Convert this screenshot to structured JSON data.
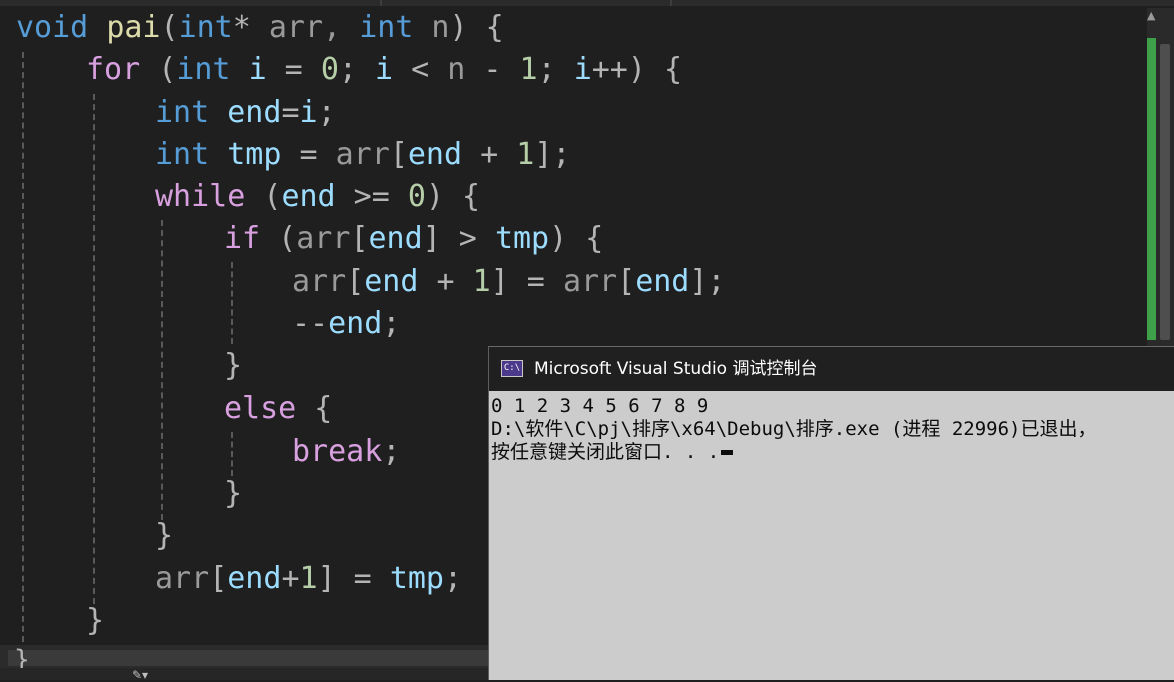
{
  "editor": {
    "lines": [
      [
        "void",
        " ",
        "pai",
        "(",
        "int",
        "*",
        " arr, ",
        "int",
        " n",
        ") {"
      ],
      [
        "for",
        " (",
        "int",
        " ",
        "i",
        " = ",
        "0",
        "; ",
        "i",
        " < ",
        "n",
        " - ",
        "1",
        "; ",
        "i",
        "++",
        ") {"
      ],
      [
        "int",
        " ",
        "end",
        "=",
        "i",
        ";"
      ],
      [
        "int",
        " ",
        "tmp",
        " = ",
        "arr",
        "[",
        "end",
        " + ",
        "1",
        "];"
      ],
      [
        "while",
        " (",
        "end",
        " >= ",
        "0",
        ") {"
      ],
      [
        "if",
        " (",
        "arr",
        "[",
        "end",
        "] > ",
        "tmp",
        ") {"
      ],
      [
        "arr",
        "[",
        "end",
        " + ",
        "1",
        "] = ",
        "arr",
        "[",
        "end",
        "];"
      ],
      [
        "--",
        "end",
        ";"
      ],
      [
        "}"
      ],
      [
        "else",
        " {"
      ],
      [
        "break",
        ";"
      ],
      [
        "}"
      ],
      [
        "}"
      ],
      [
        "arr",
        "[",
        "end",
        "+",
        "1",
        "] = ",
        "tmp",
        ";"
      ],
      [
        "}"
      ],
      [
        "}"
      ]
    ]
  },
  "console": {
    "title": "Microsoft Visual Studio 调试控制台",
    "icon_text": "C:\\",
    "icon": "console-app-icon",
    "output": [
      "0 1 2 3 4 5 6 7 8 9",
      "D:\\软件\\C\\pj\\排序\\x64\\Debug\\排序.exe (进程 22996)已退出，",
      "按任意键关闭此窗口. . ."
    ]
  },
  "colors": {
    "editor_bg": "#1f1f1f",
    "keyword_blue": "#569cd6",
    "keyword_purple": "#d8a0df",
    "function": "#dcdcaa",
    "variable": "#9cdcfe",
    "number": "#b5cea8",
    "console_bg": "#cccccc",
    "console_title_bg": "#202020",
    "scroll_change_bar": "#3fa04a"
  }
}
